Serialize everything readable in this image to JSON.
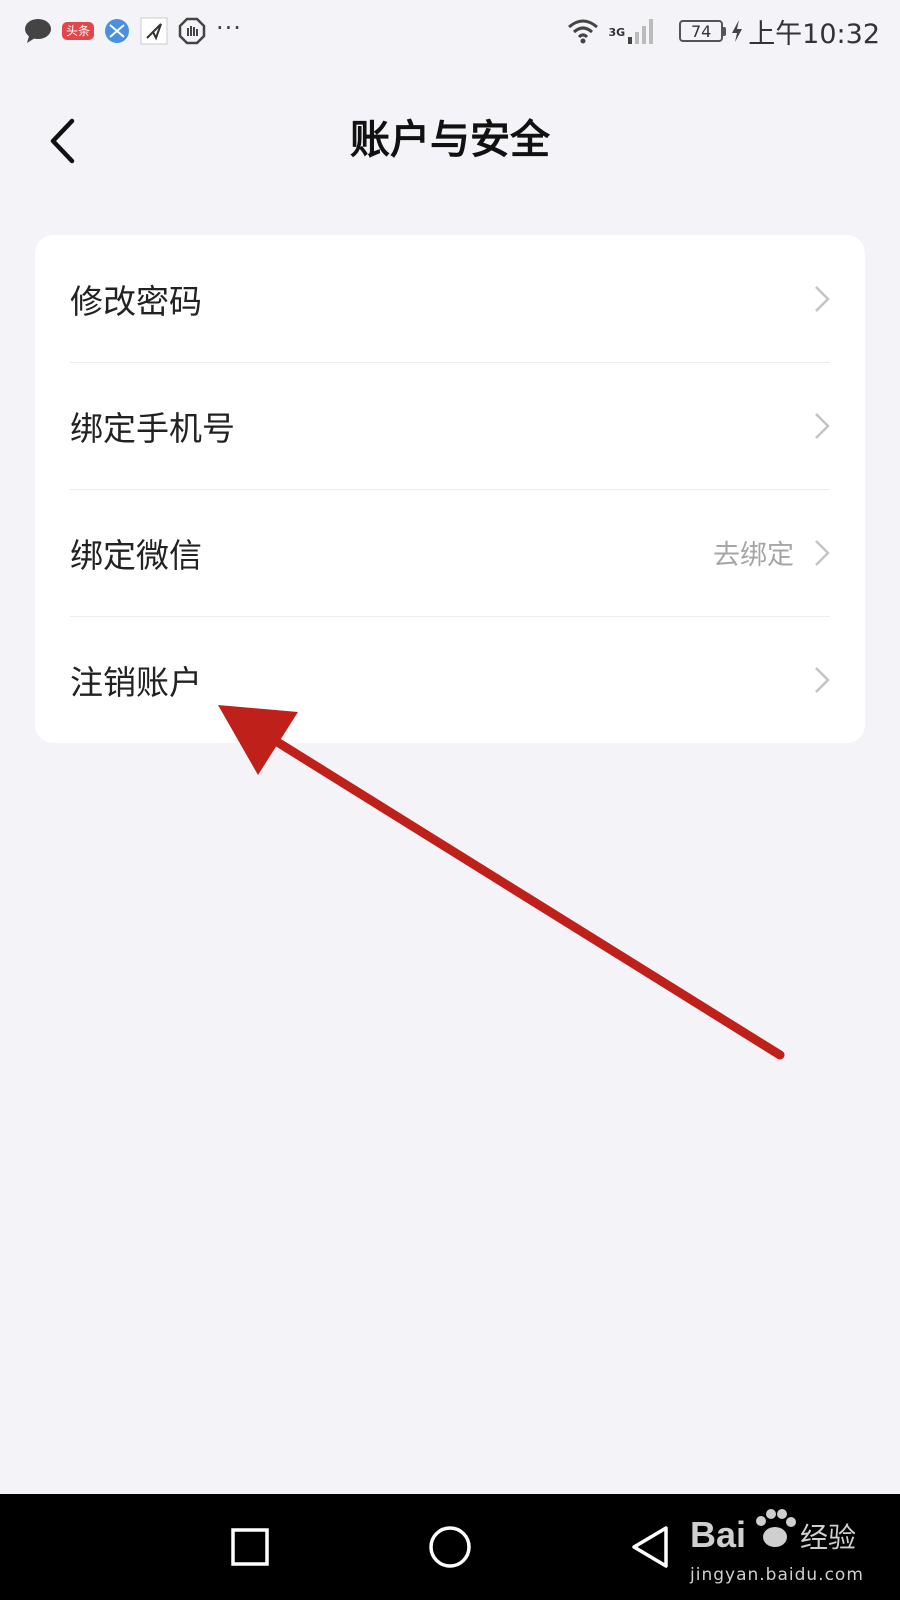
{
  "status_bar": {
    "toutiao_badge": "头条",
    "network_type": "3G",
    "battery_level": "74",
    "time": "上午10:32",
    "left_icons": [
      "message-icon",
      "toutiao-icon",
      "browser-icon",
      "send-icon",
      "shield-icon",
      "more-icon"
    ],
    "right_icons": [
      "wifi-icon",
      "signal-icon",
      "battery-icon",
      "charging-icon"
    ]
  },
  "header": {
    "back_icon": "chevron-left-icon",
    "title": "账户与安全"
  },
  "settings": {
    "items": [
      {
        "label": "修改密码",
        "value": ""
      },
      {
        "label": "绑定手机号",
        "value": ""
      },
      {
        "label": "绑定微信",
        "value": "去绑定"
      },
      {
        "label": "注销账户",
        "value": ""
      }
    ]
  },
  "annotation": {
    "type": "arrow",
    "color": "#c0201a",
    "target": "注销账户"
  },
  "nav_bar": {
    "buttons": [
      "recents-square-icon",
      "home-circle-icon",
      "back-triangle-icon"
    ]
  },
  "watermark": {
    "logo_text": "Bai",
    "logo_text_after": "经验",
    "url": "jingyan.baidu.com"
  },
  "colors": {
    "background": "#f3f3f8",
    "card": "#ffffff",
    "secondary_text": "#a6a6a6",
    "arrow": "#c0201a",
    "nav_bar": "#000000"
  }
}
